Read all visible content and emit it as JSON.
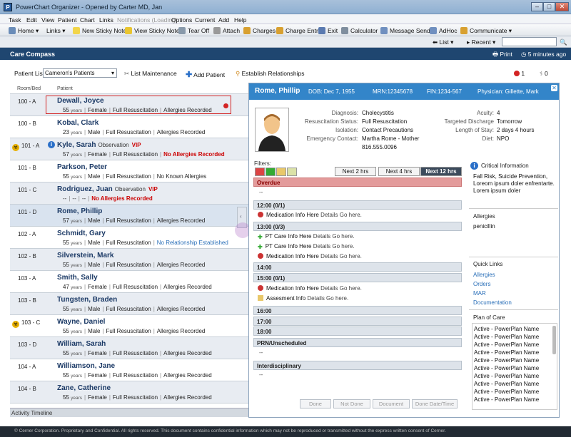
{
  "window": {
    "title": "PowerChart Organizer - Opened by Carter MD, Jan",
    "app_icon": "P"
  },
  "menu": [
    "Task",
    "Edit",
    "View",
    "Patient",
    "Chart",
    "Links",
    "Notifications (Loading)",
    "Options",
    "Current",
    "Add",
    "Help"
  ],
  "toolbar": {
    "home": "Home",
    "links": "Links",
    "new_sticky": "New Sticky Note",
    "view_sticky": "View Sticky Notes",
    "tear_off": "Tear Off",
    "attach": "Attach",
    "charges": "Charges",
    "charge_entry": "Charge Entry",
    "exit": "Exit",
    "calculator": "Calculator",
    "message_sender": "Message Sender",
    "adhoc": "AdHoc",
    "communicate": "Communicate"
  },
  "nav": {
    "list": "List",
    "recent": "Recent"
  },
  "care_compass": {
    "title": "Care Compass",
    "print": "Print",
    "updated": "5 minutes ago"
  },
  "list_bar": {
    "label": "Patient List:",
    "selected": "Cameron's Patients",
    "list_maintenance": "List Maintenance",
    "add_patient": "Add Patient",
    "establish": "Establish Relationships",
    "alert_count": "1",
    "task_count": "0"
  },
  "columns": {
    "room": "Room/Bed",
    "patient": "Patient"
  },
  "patients": [
    {
      "room": "100 - A",
      "name": "Dewall, Joyce",
      "age": "55",
      "sex": "Female",
      "code": "Full Resuscitation",
      "allergy": "Allergies Recorded"
    },
    {
      "room": "100 - B",
      "name": "Kobal, Clark",
      "age": "23",
      "sex": "Male",
      "code": "Full Resuscitation",
      "allergy": "Allergies Recorded"
    },
    {
      "room": "101 - A",
      "name": "Kyle, Sarah",
      "obs": "Observation",
      "vip": "VIP",
      "age": "57",
      "sex": "Female",
      "code": "Full Resuscitation",
      "allergy": "No Allergies Recorded"
    },
    {
      "room": "101 - B",
      "name": "Parkson, Peter",
      "age": "55",
      "sex": "Male",
      "code": "Full Resuscitation",
      "allergy": "No Known Allergies"
    },
    {
      "room": "101 - C",
      "name": "Rodriguez, Juan",
      "obs": "Observation",
      "vip": "VIP",
      "age": "--",
      "sex": "--",
      "code": "--",
      "allergy": "No Allergies Recorded"
    },
    {
      "room": "101 - D",
      "name": "Rome, Phillip",
      "age": "57",
      "sex": "Male",
      "code": "Full Resuscitation",
      "allergy": "Allergies Recorded"
    },
    {
      "room": "102 - A",
      "name": "Schmidt, Gary",
      "age": "55",
      "sex": "Male",
      "code": "Full Resuscitation",
      "allergy": "No Relationship Established"
    },
    {
      "room": "102 - B",
      "name": "Silverstein, Mark",
      "age": "55",
      "sex": "Male",
      "code": "Full Resuscitation",
      "allergy": "Allergies Recorded"
    },
    {
      "room": "103 - A",
      "name": "Smith, Sally",
      "age": "47",
      "sex": "Female",
      "code": "Full Resuscitation",
      "allergy": "Allergies Recorded"
    },
    {
      "room": "103 - B",
      "name": "Tungsten, Braden",
      "age": "55",
      "sex": "Male",
      "code": "Full Resuscitation",
      "allergy": "Allergies Recorded"
    },
    {
      "room": "103 - C",
      "name": "Wayne, Daniel",
      "age": "55",
      "sex": "Male",
      "code": "Full Resuscitation",
      "allergy": "Allergies Recorded"
    },
    {
      "room": "103 - D",
      "name": "William, Sarah",
      "age": "55",
      "sex": "Female",
      "code": "Full Resuscitation",
      "allergy": "Allergies Recorded"
    },
    {
      "room": "104 - A",
      "name": "Williamson, Jane",
      "age": "55",
      "sex": "Female",
      "code": "Full Resuscitation",
      "allergy": "Allergies Recorded"
    },
    {
      "room": "104 - B",
      "name": "Zane, Catherine",
      "age": "55",
      "sex": "Female",
      "code": "Full Resuscitation",
      "allergy": "Allergies Recorded"
    }
  ],
  "years_label": "years",
  "activity_timeline": "Activity Timeline",
  "detail": {
    "name": "Rome, Phillip",
    "dob": "DOB: Dec 7, 1955",
    "mrn": "MRN:12345678",
    "fin": "FIN:1234-567",
    "physician": "Physician: Gillette, Mark",
    "fields_left": [
      {
        "label": "Diagnosis:",
        "value": "Cholecystitis"
      },
      {
        "label": "Resuscitation Status:",
        "value": "Full Resuscitation"
      },
      {
        "label": "Isolation:",
        "value": "Contact Precautions"
      },
      {
        "label": "Emergency Contact:",
        "value": "Martha Rome - Mother"
      }
    ],
    "phone": "816.555.0096",
    "fields_right": [
      {
        "label": "Acuity:",
        "value": "4"
      },
      {
        "label": "Targeted Discharge",
        "value": "Tomorrow"
      },
      {
        "label": "Length of Stay:",
        "value": "2 days 4 hours"
      },
      {
        "label": "Diet:",
        "value": "NPO"
      }
    ],
    "filters": "Filters:",
    "time_buttons": [
      "Next 2 hrs",
      "Next 4 hrs",
      "Next 12 hrs"
    ],
    "schedule": {
      "overdue": "Overdue",
      "overdue_dash": "--",
      "t1200": "12:00 (0/1)",
      "t1300": "13:00 (0/3)",
      "t1400": "14:00",
      "t1500": "15:00 (0/1)",
      "t1600": "16:00",
      "t1700": "17:00",
      "t1800": "18:00",
      "prn": "PRN/Unscheduled",
      "prn_dash": "--",
      "inter": "Interdisciplinary",
      "inter_dash": "--",
      "i1_title": "Medication Info Here",
      "i1_det": "Details Go here.",
      "i2_title": "PT Care Info Here",
      "i2_det": "Details Go here.",
      "i3_title": "PT Care Info Here",
      "i3_det": "Details Go here.",
      "i4_title": "Medication Info Here",
      "i4_det": "Details Go here.",
      "i5_title": "Medication Info Here",
      "i5_det": "Details Go here.",
      "i6_title": "Assesment Info",
      "i6_det": "Details Go here."
    },
    "bottom_buttons": [
      "Done",
      "Not Done",
      "Document",
      "Done Date/Time"
    ]
  },
  "right": {
    "critical_title": "Critical Information",
    "critical_text": "Fall Risk, Suicide Prevention, Loreom ipsum doler enfrentarte. Lorem ipsum doler",
    "allergies_title": "Allergies",
    "allergy": "penicillin",
    "quick_title": "Quick Links",
    "links": [
      "Allergies",
      "Orders",
      "MAR",
      "Documentation"
    ],
    "plan_title": "Plan of Care",
    "plans": [
      "Active - PowerPlan Name",
      "Active - PowerPlan Name",
      "Active - PowerPlan Name",
      "Active - PowerPlan Name",
      "Active - PowerPlan Name",
      "Active - PowerPlan Name",
      "Active - PowerPlan Name",
      "Active - PowerPlan Name",
      "Active - PowerPlan Name",
      "Active - PowerPlan Name"
    ]
  },
  "footer": "© Cerner Corporation. Proprietary and Confidential. All rights reserved. This document contains confidential information which may not be reproduced or transmitted without the express written consent of Cerner."
}
